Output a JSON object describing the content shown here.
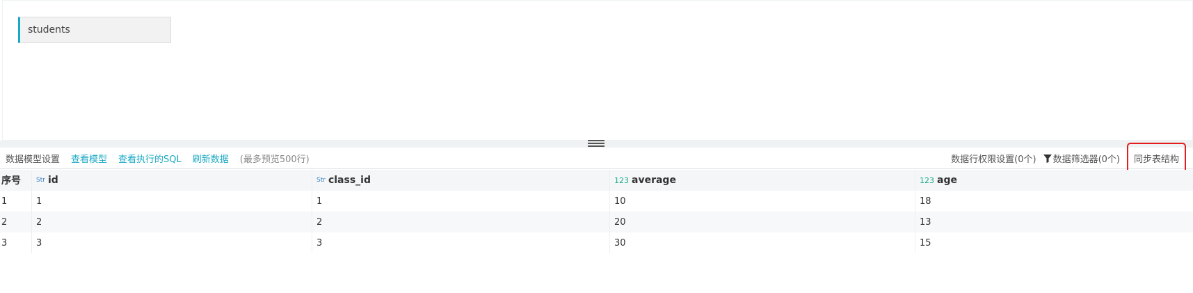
{
  "model_canvas": {
    "table_chip_label": "students"
  },
  "toolbar": {
    "model_settings": "数据模型设置",
    "view_model": "查看模型",
    "view_sql": "查看执行的SQL",
    "refresh_data": "刷新数据",
    "preview_hint": "(最多预览500行)",
    "row_permission": "数据行权限设置(0个)",
    "filter_icon": "filter-icon",
    "data_filter": "数据筛选器(0个)",
    "sync_structure": "同步表结构"
  },
  "grid": {
    "seq_header": "序号",
    "columns": [
      {
        "type": "Str",
        "name": "id"
      },
      {
        "type": "Str",
        "name": "class_id"
      },
      {
        "type": "123",
        "name": "average"
      },
      {
        "type": "123",
        "name": "age"
      }
    ],
    "rows": [
      [
        "1",
        "1",
        "1",
        "10",
        "18"
      ],
      [
        "2",
        "2",
        "2",
        "20",
        "13"
      ],
      [
        "3",
        "3",
        "3",
        "30",
        "15"
      ]
    ]
  },
  "colors": {
    "accent": "#1aa9c4",
    "highlight_border": "#e41e1e"
  }
}
